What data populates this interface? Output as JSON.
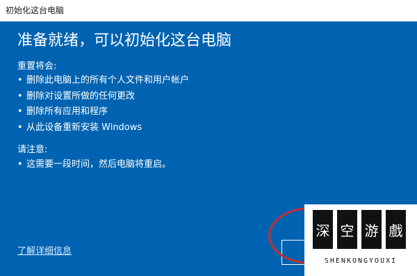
{
  "window": {
    "title": "初始化这台电脑"
  },
  "main": {
    "heading": "准备就绪，可以初始化这台电脑",
    "reset_label": "重置将会:",
    "reset_items": [
      "删除此电脑上的所有个人文件和用户帐户",
      "删除对设置所做的任何更改",
      "删除所有应用和程序",
      "从此设备重新安装 Windows"
    ],
    "note_label": "请注意:",
    "note_items": [
      "这需要一段时间，然后电脑将重启。"
    ],
    "details_link": "了解详细信息",
    "bullet": "•"
  },
  "watermark": {
    "chars": [
      "深",
      "空",
      "游",
      "戲"
    ],
    "subtitle": "SHENKONGYOUXI"
  },
  "colors": {
    "panel_background": "#0063b1",
    "titlebar_background": "#ffffff",
    "annotation": "#c82d2d"
  }
}
